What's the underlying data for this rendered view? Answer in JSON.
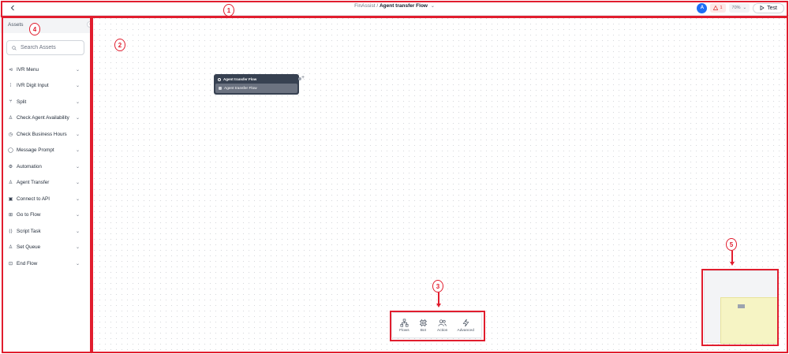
{
  "header": {
    "back_icon": "chevron-left-icon",
    "breadcrumb_root": "FinAssist",
    "breadcrumb_sep": "/",
    "breadcrumb_current": "Agent transfer Flow",
    "avatar_initial": "A",
    "avatar_color": "#1d6ef5",
    "warning_count": "1",
    "zoom_level": "70%",
    "test_label": "Test"
  },
  "sidebar": {
    "title": "Assets",
    "search_placeholder": "Search Assets",
    "items": [
      {
        "label": "IVR Menu",
        "icon": "ivr-menu-icon"
      },
      {
        "label": "IVR Digit Input",
        "icon": "keypad-icon"
      },
      {
        "label": "Split",
        "icon": "split-icon"
      },
      {
        "label": "Check Agent Availability",
        "icon": "user-icon"
      },
      {
        "label": "Check Business Hours",
        "icon": "clock-icon"
      },
      {
        "label": "Message Prompt",
        "icon": "message-icon"
      },
      {
        "label": "Automation",
        "icon": "automation-icon"
      },
      {
        "label": "Agent Transfer",
        "icon": "agent-icon"
      },
      {
        "label": "Connect to API",
        "icon": "api-icon"
      },
      {
        "label": "Go to Flow",
        "icon": "flow-icon"
      },
      {
        "label": "Script Task",
        "icon": "code-icon"
      },
      {
        "label": "Set Queue",
        "icon": "queue-icon"
      },
      {
        "label": "End Flow",
        "icon": "end-icon"
      }
    ]
  },
  "canvas": {
    "node": {
      "title": "Agent transfer Flow",
      "body": "Agent transfer Flow"
    }
  },
  "toolbar": {
    "items": [
      {
        "label": "Flows",
        "icon": "flows-icon"
      },
      {
        "label": "Bot",
        "icon": "bot-icon"
      },
      {
        "label": "Action",
        "icon": "action-icon"
      },
      {
        "label": "Advanced",
        "icon": "lightning-icon"
      }
    ]
  },
  "annotations": {
    "labels": [
      "1",
      "2",
      "3",
      "4",
      "5"
    ],
    "color": "#e11d2e"
  }
}
